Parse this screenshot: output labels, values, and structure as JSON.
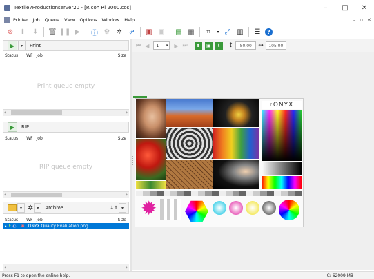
{
  "window": {
    "title": "Textile7Productionserver20 - [Ricoh Ri 2000.cos]",
    "minimize": "–",
    "maximize": "□",
    "close": "✕"
  },
  "menu": [
    {
      "label": "Printer",
      "key": "P"
    },
    {
      "label": "Job",
      "key": "J"
    },
    {
      "label": "Queue",
      "key": "Q"
    },
    {
      "label": "View",
      "key": "V"
    },
    {
      "label": "Options",
      "key": "O"
    },
    {
      "label": "Window",
      "key": "W"
    },
    {
      "label": "Help",
      "key": "H"
    }
  ],
  "mdi_controls": {
    "minimize": "–",
    "restore": "▫",
    "close": "✕"
  },
  "print_panel": {
    "title": "Print",
    "col_status": "Status",
    "col_wf": "WF",
    "col_job": "Job",
    "col_size": "Size",
    "empty": "Print queue empty"
  },
  "rip_panel": {
    "title": "RIP",
    "col_status": "Status",
    "col_wf": "WF",
    "col_job": "Job",
    "col_size": "Size",
    "empty": "RIP queue empty"
  },
  "archive_panel": {
    "title": "Archive",
    "col_status": "Status",
    "col_wf": "WF",
    "col_job": "Job",
    "col_size": "Size",
    "rows": [
      {
        "job": "ONYX Quality Evaluation.png",
        "selected": true
      }
    ]
  },
  "preview": {
    "page": "1",
    "width_value": "80.00",
    "height_value": "105.00",
    "brand": "ONYX"
  },
  "status": {
    "help": "Press F1 to open the online help.",
    "memory": "C: 62009 MB"
  },
  "colors": {
    "selection": "#0078d7",
    "accent_green": "#3a9a3a",
    "info_blue": "#1a6fd0"
  }
}
